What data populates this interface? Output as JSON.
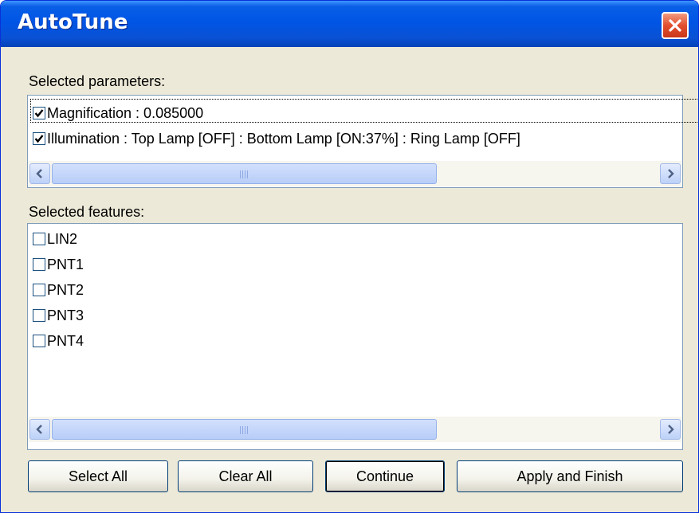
{
  "window": {
    "title": "AutoTune"
  },
  "parameters": {
    "label": "Selected parameters:",
    "items": [
      {
        "label": "Magnification : 0.085000",
        "checked": true
      },
      {
        "label": "Illumination : Top Lamp [OFF] : Bottom Lamp [ON:37%] : Ring Lamp [OFF]",
        "checked": true
      }
    ]
  },
  "features": {
    "label": "Selected features:",
    "items": [
      {
        "label": "LIN2",
        "checked": false
      },
      {
        "label": "PNT1",
        "checked": false
      },
      {
        "label": "PNT2",
        "checked": false
      },
      {
        "label": "PNT3",
        "checked": false
      },
      {
        "label": "PNT4",
        "checked": false
      }
    ]
  },
  "buttons": {
    "select_all": "Select All",
    "clear_all": "Clear All",
    "continue": "Continue",
    "apply_finish": "Apply and Finish"
  },
  "icons": {
    "close": "close-icon",
    "check": "checkmark-icon",
    "scroll_left": "arrow-left-icon",
    "scroll_right": "arrow-right-icon"
  },
  "colors": {
    "title_bar": "#0055e5",
    "close_button": "#e24f2f",
    "window_bg": "#ece9d8",
    "list_border": "#7f9db9"
  }
}
